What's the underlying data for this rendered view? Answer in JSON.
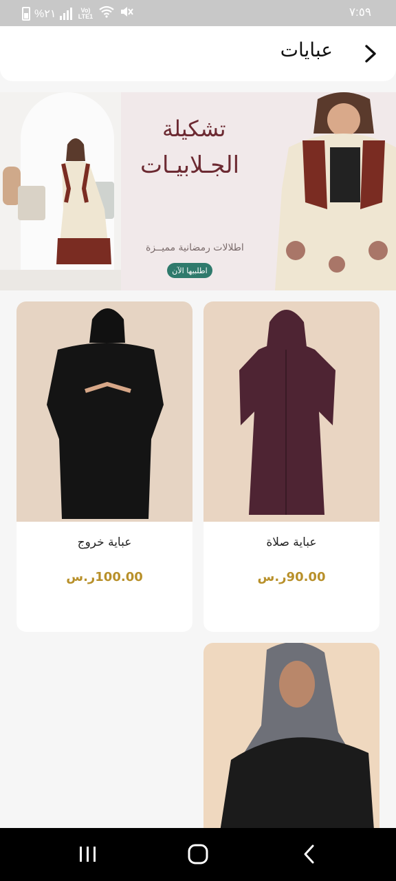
{
  "status_bar": {
    "time": "٧:٥٩",
    "battery_percent": "%٢١",
    "network": "Vo) LTE1"
  },
  "header": {
    "title": "عبايات",
    "back_icon": "chevron-right-icon"
  },
  "banner": {
    "heading_line1": "تشكيلة",
    "heading_line2": "الجـلابيـات",
    "subtitle": "اطلالات رمضانية مميــزة",
    "cta_label": "اطلبيها الآن"
  },
  "products": [
    {
      "name": "عباية صلاة",
      "price": "90.00ر.س"
    },
    {
      "name": "عباية خروج",
      "price": "100.00ر.س"
    },
    {
      "name": "",
      "price": ""
    }
  ],
  "colors": {
    "price": "#b8902a",
    "banner_heading": "#6c2a32",
    "cta": "#2f7a6c"
  },
  "nav_bar": {
    "recents_icon": "recents-icon",
    "home_icon": "home-icon",
    "back_icon": "back-icon"
  }
}
